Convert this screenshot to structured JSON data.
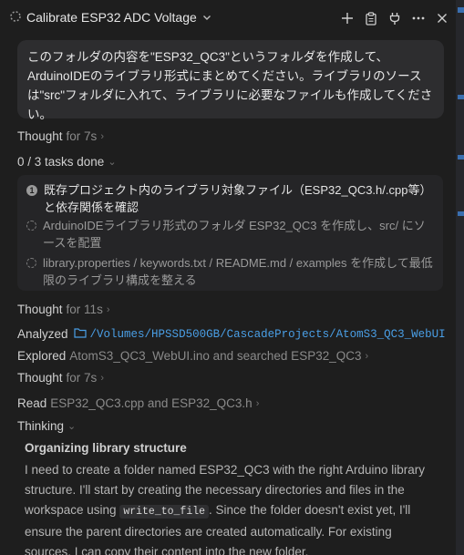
{
  "header": {
    "title": "Calibrate ESP32 ADC Voltage",
    "icons": [
      "plus-icon",
      "clipboard-icon",
      "plug-icon",
      "more-icon",
      "close-icon"
    ]
  },
  "message": {
    "text": "このフォルダの内容を\"ESP32_QC3\"というフォルダを作成して、ArduinoIDEのライブラリ形式にまとめてください。ライブラリのソースは\"src\"フォルダに入れて、ライブラリに必要なファイルも作成してください。"
  },
  "steps": {
    "thought1": {
      "label": "Thought",
      "detail": "for 7s"
    },
    "tasks_done": "0 / 3 tasks done",
    "tasks": [
      {
        "num": "1",
        "text": "既存プロジェクト内のライブラリ対象ファイル（ESP32_QC3.h/.cpp等）と依存関係を確認"
      },
      {
        "text": "ArduinoIDEライブラリ形式のフォルダ ESP32_QC3 を作成し、src/ にソースを配置"
      },
      {
        "text": "library.properties / keywords.txt / README.md / examples を作成して最低限のライブラリ構成を整える"
      }
    ],
    "thought2": {
      "label": "Thought",
      "detail": "for 11s"
    },
    "analyzed": {
      "label": "Analyzed",
      "path": "/Volumes/HPSSD500GB/CascadeProjects/AtomS3_QC3_WebUI"
    },
    "explored": {
      "label": "Explored",
      "detail": "AtomS3_QC3_WebUI.ino and searched ESP32_QC3"
    },
    "thought3": {
      "label": "Thought",
      "detail": "for 7s"
    },
    "read": {
      "label": "Read",
      "detail": "ESP32_QC3.cpp and ESP32_QC3.h"
    },
    "thinking": {
      "label": "Thinking"
    }
  },
  "thinking_block": {
    "title": "Organizing library structure",
    "body_part1": "I need to create a folder named ESP32_QC3 with the right Arduino library structure. I'll start by creating the necessary directories and files in the workspace using ",
    "code": "write_to_file",
    "body_part2": ". Since the folder doesn't exist yet, I'll ensure the parent directories are created automatically. For existing sources, I can copy their content into the new folder."
  },
  "colors": {
    "background": "#1e1e1e",
    "bubble": "#2d2d2f",
    "link": "#4a9fe6"
  }
}
